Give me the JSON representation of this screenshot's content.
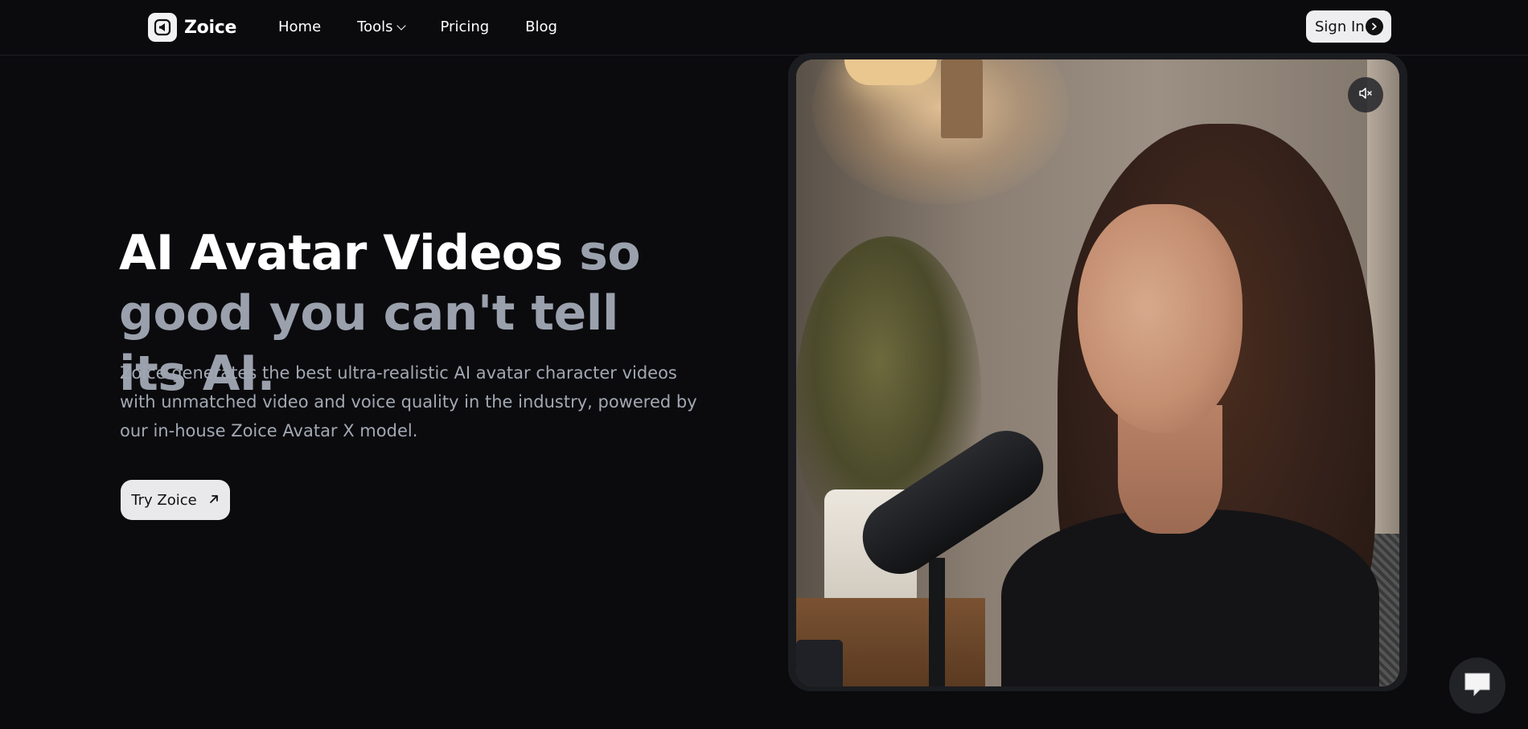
{
  "brand": {
    "name": "Zoice",
    "logo_icon": "speaker-play-icon"
  },
  "nav": {
    "items": [
      {
        "label": "Home"
      },
      {
        "label": "Tools",
        "has_dropdown": true
      },
      {
        "label": "Pricing"
      },
      {
        "label": "Blog"
      }
    ]
  },
  "header": {
    "signin_label": "Sign In",
    "signin_icon": "chevron-right-circle-icon"
  },
  "hero": {
    "title_highlight": "AI Avatar Videos",
    "title_rest": "so good you can't tell its AI.",
    "description": "Zoice generates the best ultra-realistic AI avatar character videos with unmatched video and voice quality in the industry, powered by our in-house Zoice Avatar X model.",
    "cta_label": "Try Zoice",
    "cta_icon": "arrow-up-right-icon"
  },
  "video": {
    "mute_icon": "volume-muted-icon",
    "muted": true
  },
  "chat": {
    "icon": "chat-bubble-icon"
  },
  "colors": {
    "background": "#0b0b0e",
    "title_muted": "#9aa1ad",
    "body_text": "#a2a8b3",
    "button_bg": "#e9e9ec"
  }
}
